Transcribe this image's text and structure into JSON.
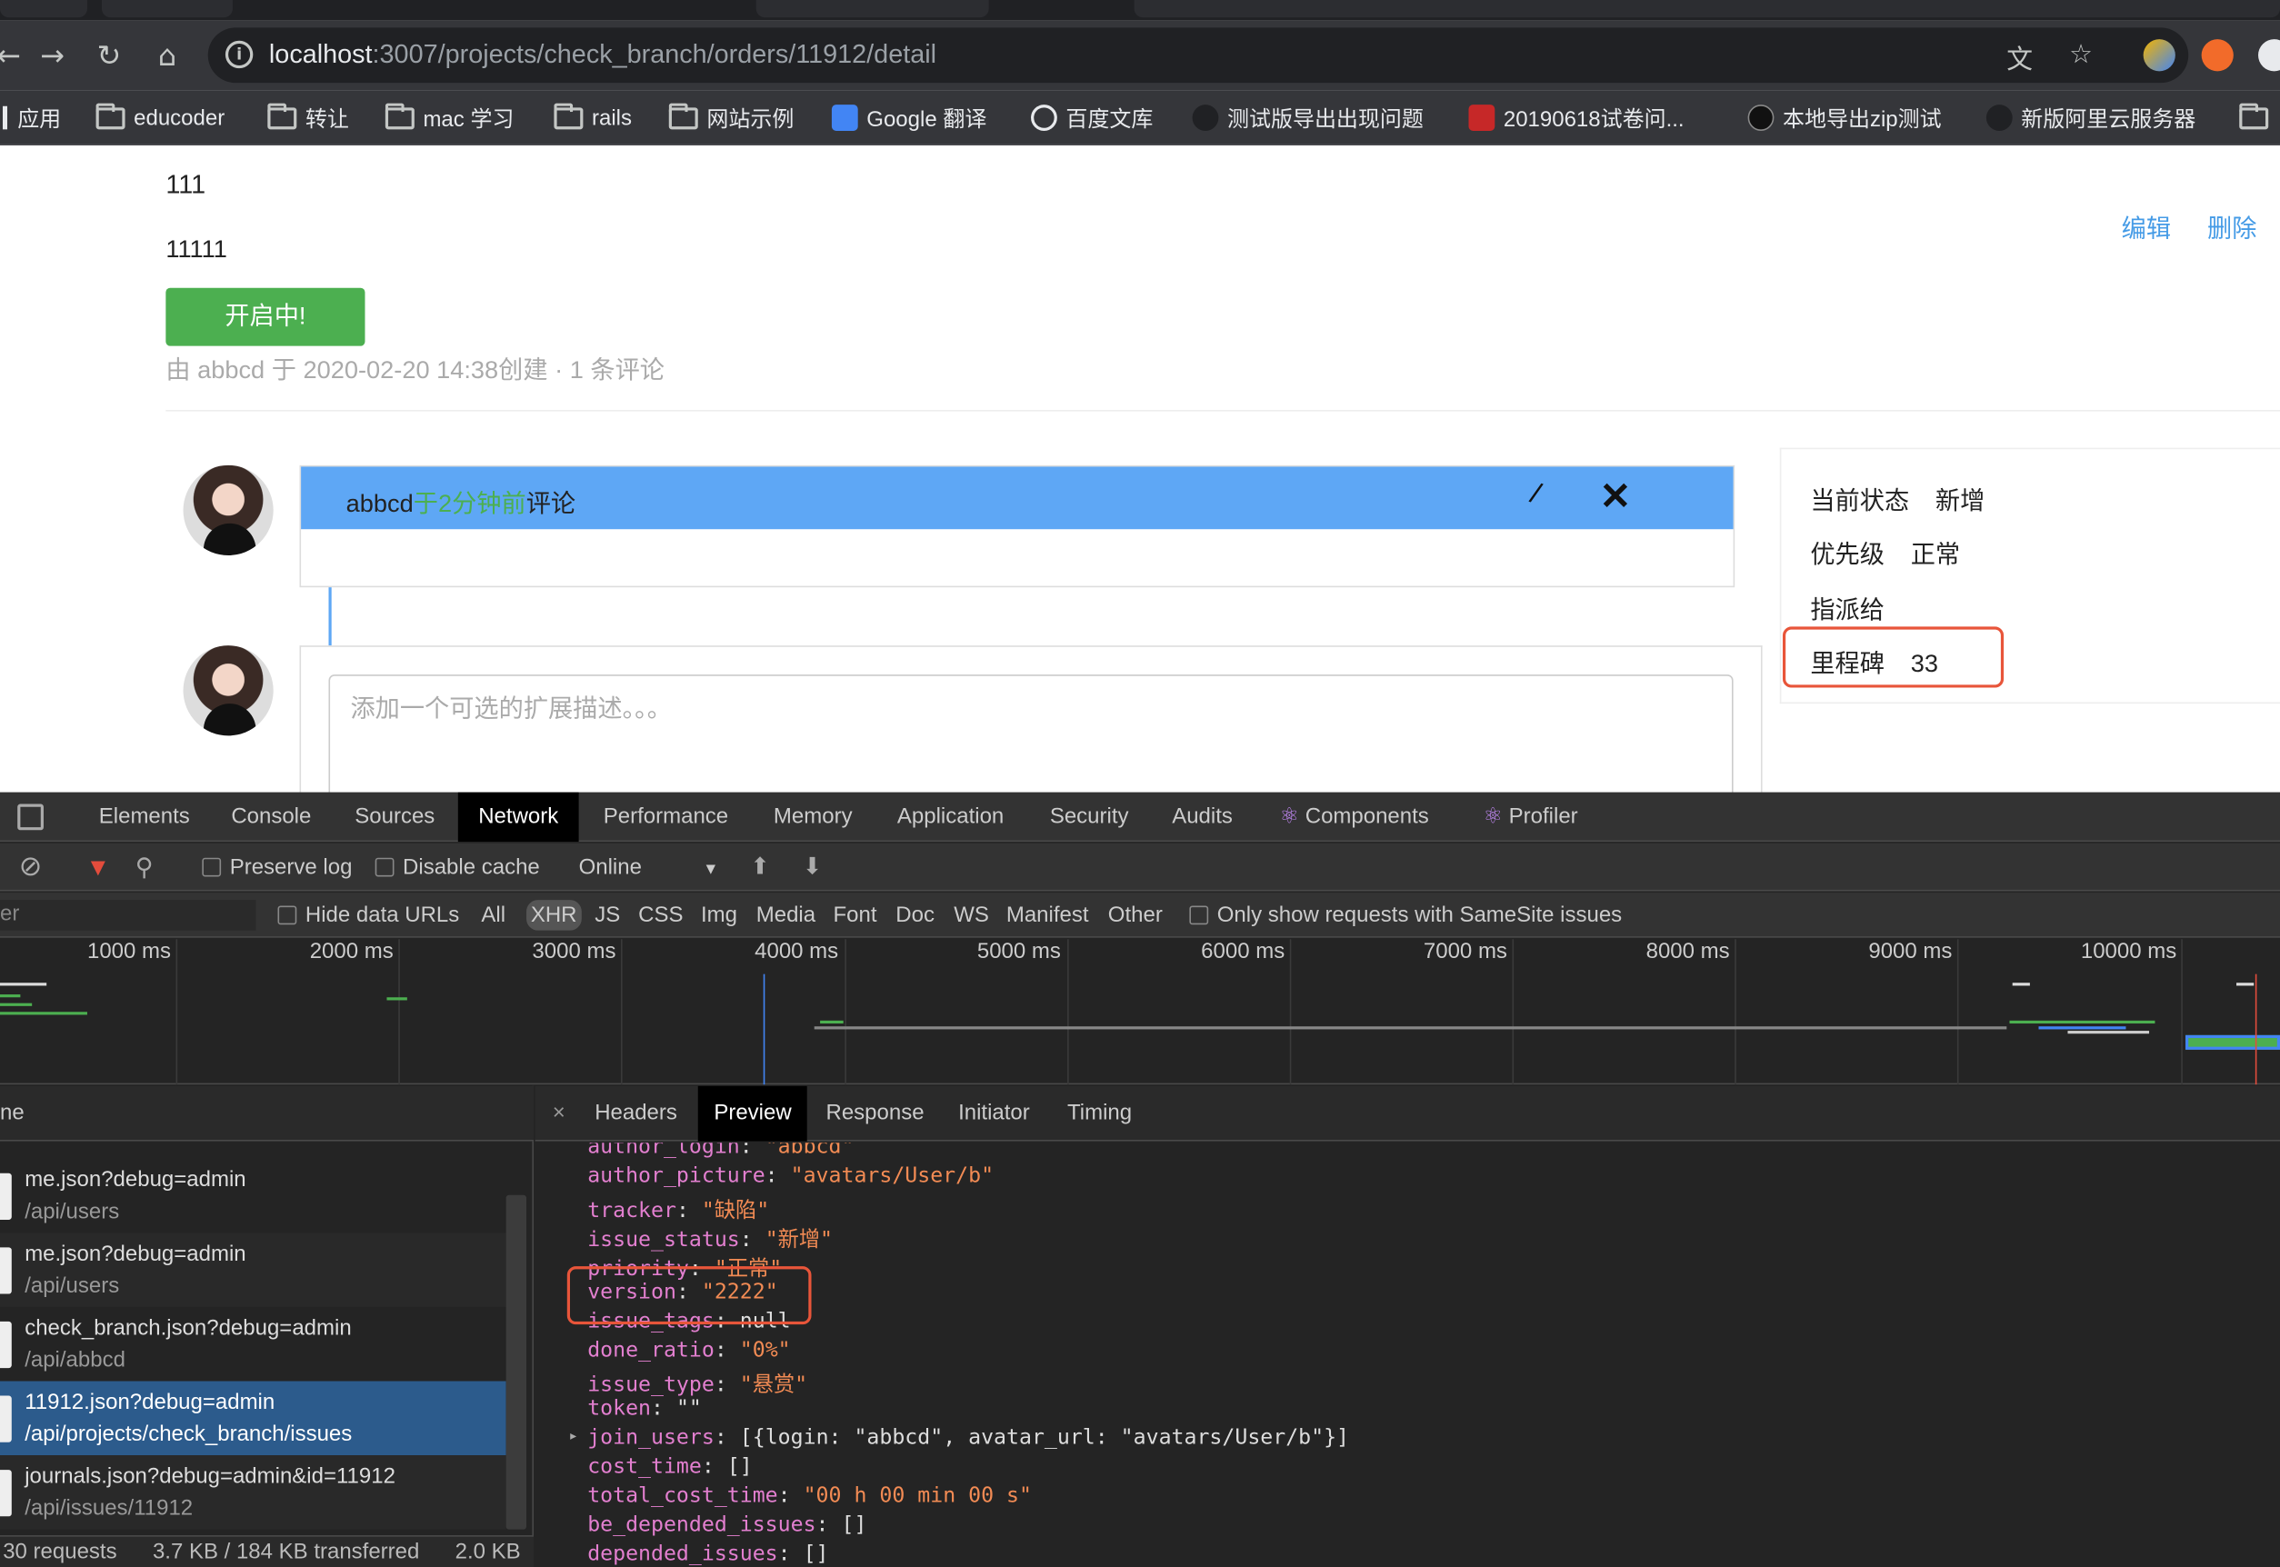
{
  "browser": {
    "url_host": "localhost",
    "url_rest": ":3007/projects/check_branch/orders/11912/detail",
    "bookmarks": [
      "应用",
      "educoder",
      "转让",
      "mac 学习",
      "rails",
      "网站示例",
      "Google 翻译",
      "百度文库",
      "测试版导出出现问题",
      "20190618试卷问...",
      "本地导出zip测试",
      "新版阿里云服务器"
    ]
  },
  "issue": {
    "title": "111",
    "description": "11111",
    "status_button": "开启中!",
    "meta": "由 abbcd 于 2020-02-20 14:38创建 · 1 条评论",
    "edit": "编辑",
    "delete": "删除"
  },
  "comment": {
    "author": "abbcd",
    "time": "于2分钟前",
    "suffix": "评论",
    "placeholder": "添加一个可选的扩展描述。。。"
  },
  "sidebar": {
    "status_label": "当前状态",
    "status_value": "新增",
    "priority_label": "优先级",
    "priority_value": "正常",
    "assignee_label": "指派给",
    "milestone_label": "里程碑",
    "milestone_value": "33"
  },
  "devtools": {
    "tabs": [
      "Elements",
      "Console",
      "Sources",
      "Network",
      "Performance",
      "Memory",
      "Application",
      "Security",
      "Audits",
      "Components",
      "Profiler"
    ],
    "active_tab": "Network",
    "toolbar": {
      "preserve_log": "Preserve log",
      "disable_cache": "Disable cache",
      "throttle": "Online"
    },
    "filter": {
      "placeholder": "er",
      "hide_data_urls": "Hide data URLs",
      "types": [
        "All",
        "XHR",
        "JS",
        "CSS",
        "Img",
        "Media",
        "Font",
        "Doc",
        "WS",
        "Manifest",
        "Other"
      ],
      "selected": "XHR",
      "samesite": "Only show requests with SameSite issues"
    },
    "ticks": [
      "1000 ms",
      "2000 ms",
      "3000 ms",
      "4000 ms",
      "5000 ms",
      "6000 ms",
      "7000 ms",
      "8000 ms",
      "9000 ms",
      "10000 ms"
    ],
    "name_header": "ne",
    "requests": [
      {
        "name": "me.json?debug=admin",
        "path": "/api/users"
      },
      {
        "name": "me.json?debug=admin",
        "path": "/api/users"
      },
      {
        "name": "check_branch.json?debug=admin",
        "path": "/api/abbcd"
      },
      {
        "name": "11912.json?debug=admin",
        "path": "/api/projects/check_branch/issues"
      },
      {
        "name": "journals.json?debug=admin&id=11912",
        "path": "/api/issues/11912"
      }
    ],
    "status": {
      "requests": "30 requests",
      "transferred": "3.7 KB / 184 KB transferred",
      "size": "2.0 KB"
    },
    "detail_tabs": [
      "Headers",
      "Preview",
      "Response",
      "Initiator",
      "Timing"
    ],
    "detail_active": "Preview",
    "preview": [
      {
        "key": "author_login",
        "val": "\"abbcd\""
      },
      {
        "key": "author_picture",
        "val": "\"avatars/User/b\""
      },
      {
        "key": "tracker",
        "val": "\"缺陷\""
      },
      {
        "key": "issue_status",
        "val": "\"新增\""
      },
      {
        "key": "priority",
        "val": "\"正常\""
      },
      {
        "key": "version",
        "val": "\"2222\""
      },
      {
        "key": "issue_tags",
        "val": "null"
      },
      {
        "key": "done_ratio",
        "val": "\"0%\""
      },
      {
        "key": "issue_type",
        "val": "\"悬赏\""
      },
      {
        "key": "token",
        "val": "\"\""
      },
      {
        "key": "join_users",
        "val": "[{login: \"abbcd\", avatar_url: \"avatars/User/b\"}]"
      },
      {
        "key": "cost_time",
        "val": "[]"
      },
      {
        "key": "total_cost_time",
        "val": "\"00 h 00 min 00 s\""
      },
      {
        "key": "be_depended_issues",
        "val": "[]"
      },
      {
        "key": "depended_issues",
        "val": "[]"
      }
    ]
  }
}
